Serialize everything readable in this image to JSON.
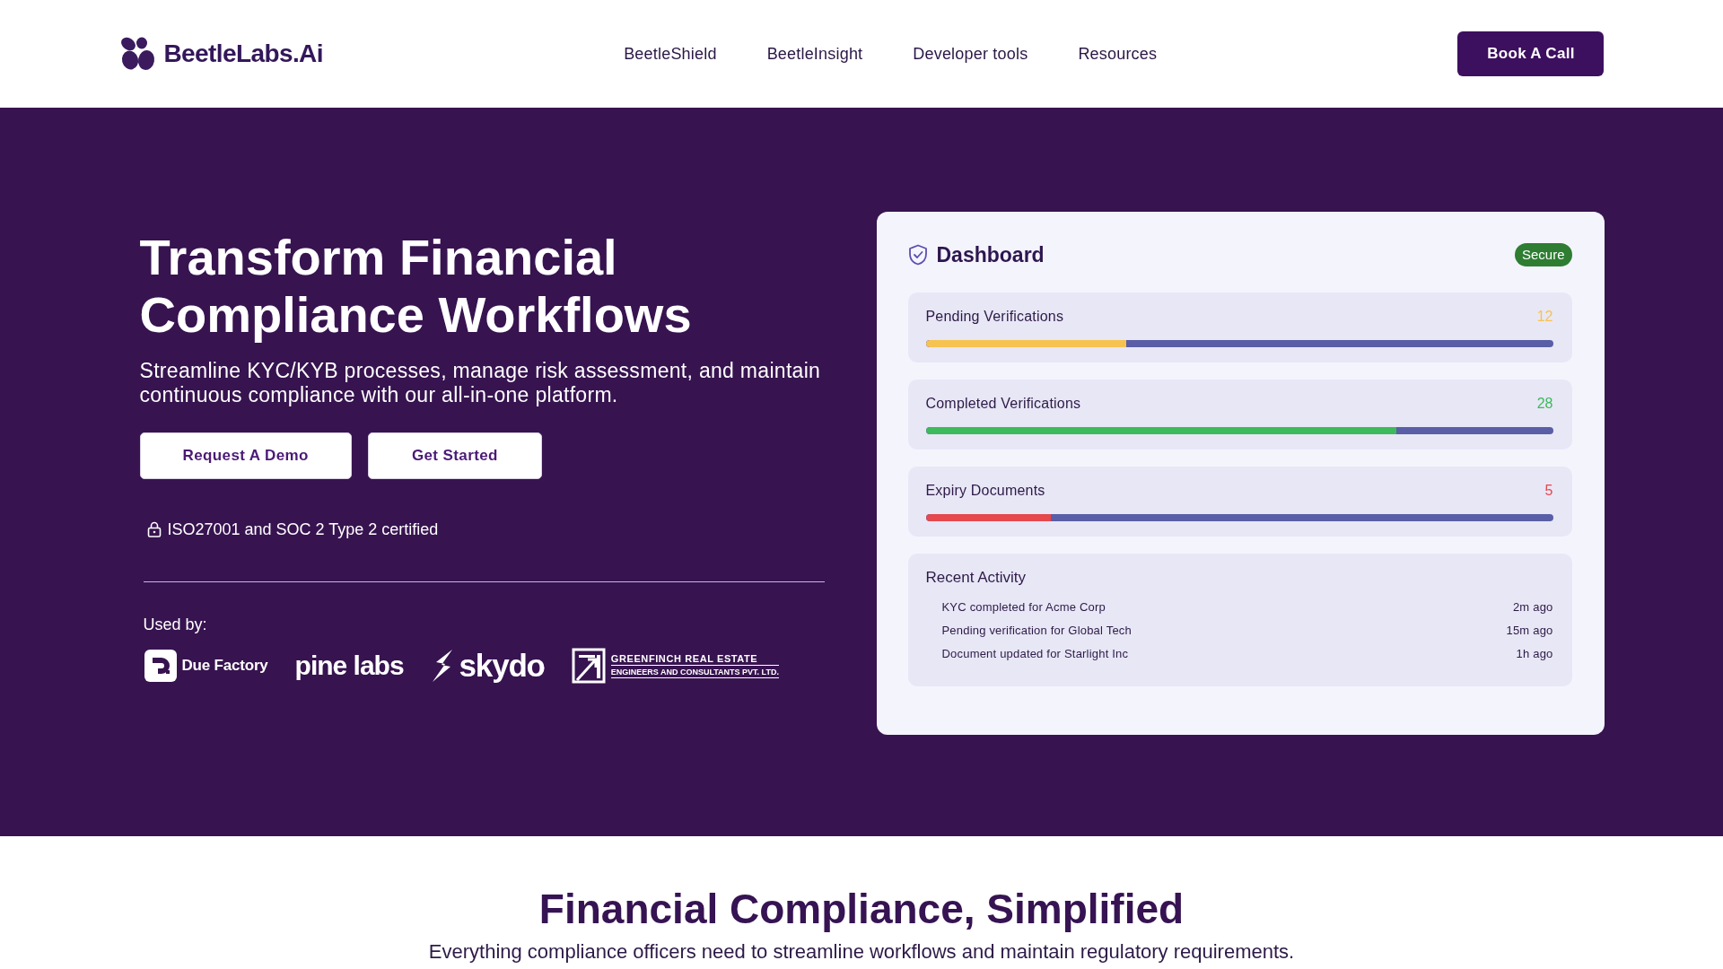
{
  "header": {
    "brand": "BeetleLabs.Ai",
    "nav": [
      "BeetleShield",
      "BeetleInsight",
      "Developer tools",
      "Resources"
    ],
    "cta": "Book A Call"
  },
  "hero": {
    "title": "Transform Financial Compliance Workflows",
    "subtitle": "Streamline KYC/KYB processes, manage risk assessment, and maintain continuous compliance with our all-in-one platform.",
    "buttons": [
      "Request A Demo",
      "Get Started"
    ],
    "certification": "ISO27001 and SOC 2 Type 2 certified",
    "used_by_label": "Used by:",
    "clients": [
      {
        "kind": "tile-mark",
        "name": "Due Factory"
      },
      {
        "kind": "wordmark",
        "name": "pine labs"
      },
      {
        "kind": "bolt-mark",
        "name": "skydo"
      },
      {
        "kind": "frame-mark",
        "name": "GREENFINCH REAL ESTATE",
        "tagline": "ENGINEERS AND CONSULTANTS PVT. LTD."
      }
    ]
  },
  "dashboard": {
    "title": "Dashboard",
    "badge": "Secure",
    "metrics": [
      {
        "label": "Pending Verifications",
        "value": "12",
        "level": 0.32,
        "color": "#f6c350"
      },
      {
        "label": "Completed Verifications",
        "value": "28",
        "level": 0.75,
        "color": "#3dba5b"
      },
      {
        "label": "Expiry Documents",
        "value": "5",
        "level": 0.2,
        "color": "#e5484d"
      }
    ],
    "recent_activity": {
      "title": "Recent Activity",
      "items": [
        {
          "text": "KYC completed for Acme Corp",
          "time": "2m ago"
        },
        {
          "text": "Pending verification for Global Tech",
          "time": "15m ago"
        },
        {
          "text": "Document updated for Starlight Inc",
          "time": "1h ago"
        }
      ]
    }
  },
  "features": {
    "title": "Financial Compliance, Simplified",
    "subtitle": "Everything compliance officers need to streamline workflows and maintain regulatory requirements."
  }
}
